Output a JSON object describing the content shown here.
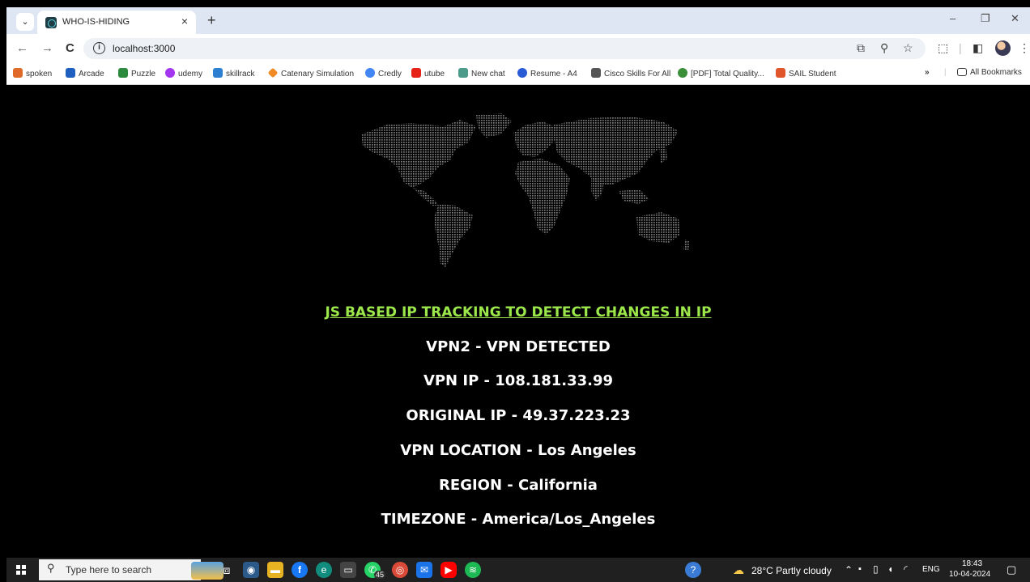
{
  "browser": {
    "tab": {
      "title": "WHO-IS-HIDING",
      "close": "×"
    },
    "new_tab": "+",
    "window": {
      "minimize": "–",
      "maximize": "❐",
      "close": "✕"
    },
    "nav": {
      "back": "←",
      "forward": "→",
      "reload": "C"
    },
    "url": "localhost:3000",
    "bookmarks": [
      {
        "label": "spoken",
        "color": "#e06a2a"
      },
      {
        "label": "Arcade",
        "color": "#1f5fbf"
      },
      {
        "label": "Puzzle",
        "color": "#2b8a3e"
      },
      {
        "label": "udemy",
        "color": "#a435f0"
      },
      {
        "label": "skillrack",
        "color": "#2d7fd1"
      },
      {
        "label": "Catenary Simulation",
        "color": "#f08a24"
      },
      {
        "label": "Credly",
        "color": "#4285f4"
      },
      {
        "label": "utube",
        "color": "#e62117"
      },
      {
        "label": "New chat",
        "color": "#4c9a8a"
      },
      {
        "label": "Resume - A4",
        "color": "#2a5bd7"
      },
      {
        "label": "Cisco Skills For All",
        "color": "#555555"
      },
      {
        "label": "[PDF] Total Quality...",
        "color": "#3b8f3b"
      },
      {
        "label": "SAIL Student",
        "color": "#e0562a"
      }
    ],
    "bookmarks_more": "»",
    "all_bookmarks": "All Bookmarks"
  },
  "page": {
    "heading": "JS BASED IP TRACKING TO DETECT CHANGES IN IP",
    "lines": [
      "VPN2 - VPN DETECTED",
      "VPN IP - 108.181.33.99",
      "ORIGINAL IP - 49.37.223.23",
      "VPN LOCATION - Los Angeles",
      "REGION - California",
      "TIMEZONE - America/Los_Angeles"
    ],
    "colors": {
      "heading": "#9ce84a",
      "text": "#ffffff",
      "background": "#000000"
    }
  },
  "taskbar": {
    "search_placeholder": "Type here to search",
    "whatsapp_badge": "45",
    "weather": "28°C  Partly cloudy",
    "lang": "ENG",
    "time": "18:43",
    "date": "10-04-2024"
  }
}
